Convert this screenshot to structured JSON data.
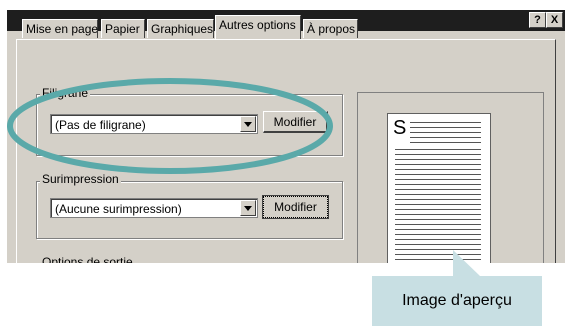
{
  "titlebar": {
    "help_label": "?",
    "close_label": "X"
  },
  "tabs": [
    {
      "label": "Mise en page"
    },
    {
      "label": "Papier"
    },
    {
      "label": "Graphiques"
    },
    {
      "label": "Autres options"
    },
    {
      "label": "À propos"
    }
  ],
  "watermark": {
    "legend": "Filigrane",
    "selected": "(Pas de filigrane)",
    "edit_label": "Modifier"
  },
  "overlay": {
    "legend": "Surimpression",
    "selected": "(Aucune surimpression)",
    "edit_label": "Modifier"
  },
  "output": {
    "legend": "Options de sortie"
  },
  "preview": {
    "page_letter": "S",
    "callout": "Image d'aperçu"
  },
  "colors": {
    "highlight_ellipse": "#5aa9a9",
    "callout_bg": "#c8dfe3",
    "dialog_bg": "#d4d0c8"
  }
}
